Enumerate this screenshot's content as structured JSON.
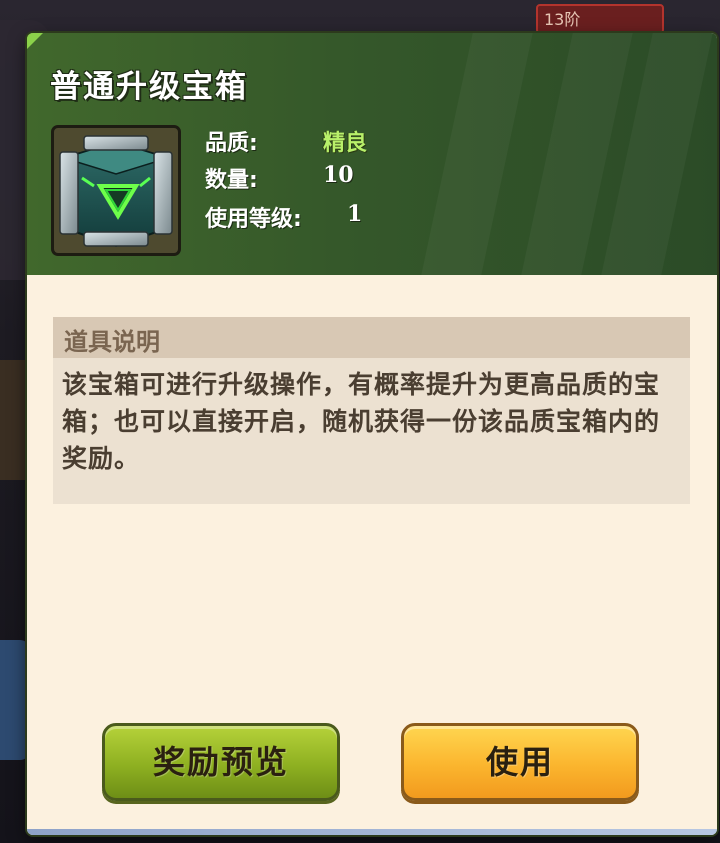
{
  "background": {
    "rank_chip": "13阶"
  },
  "dialog": {
    "title": "普通升级宝箱",
    "item_icon": "upgrade-chest-icon",
    "stats": {
      "quality_label": "品质:",
      "quality_value": "精良",
      "quantity_label": "数量:",
      "quantity_value": "10",
      "level_label": "使用等级:",
      "level_value": "1"
    },
    "description": {
      "heading": "道具说明",
      "text": "该宝箱可进行升级操作，有概率提升为更高品质的宝箱；也可以直接开启，随机获得一份该品质宝箱内的奖励。"
    },
    "buttons": {
      "preview_label": "奖励预览",
      "use_label": "使用"
    }
  },
  "colors": {
    "header_green": "#35582a",
    "panel_cream": "#fcf1df",
    "quality_green": "#b8f06a",
    "preview_button": "#8eb021",
    "use_button": "#fbb52e"
  }
}
